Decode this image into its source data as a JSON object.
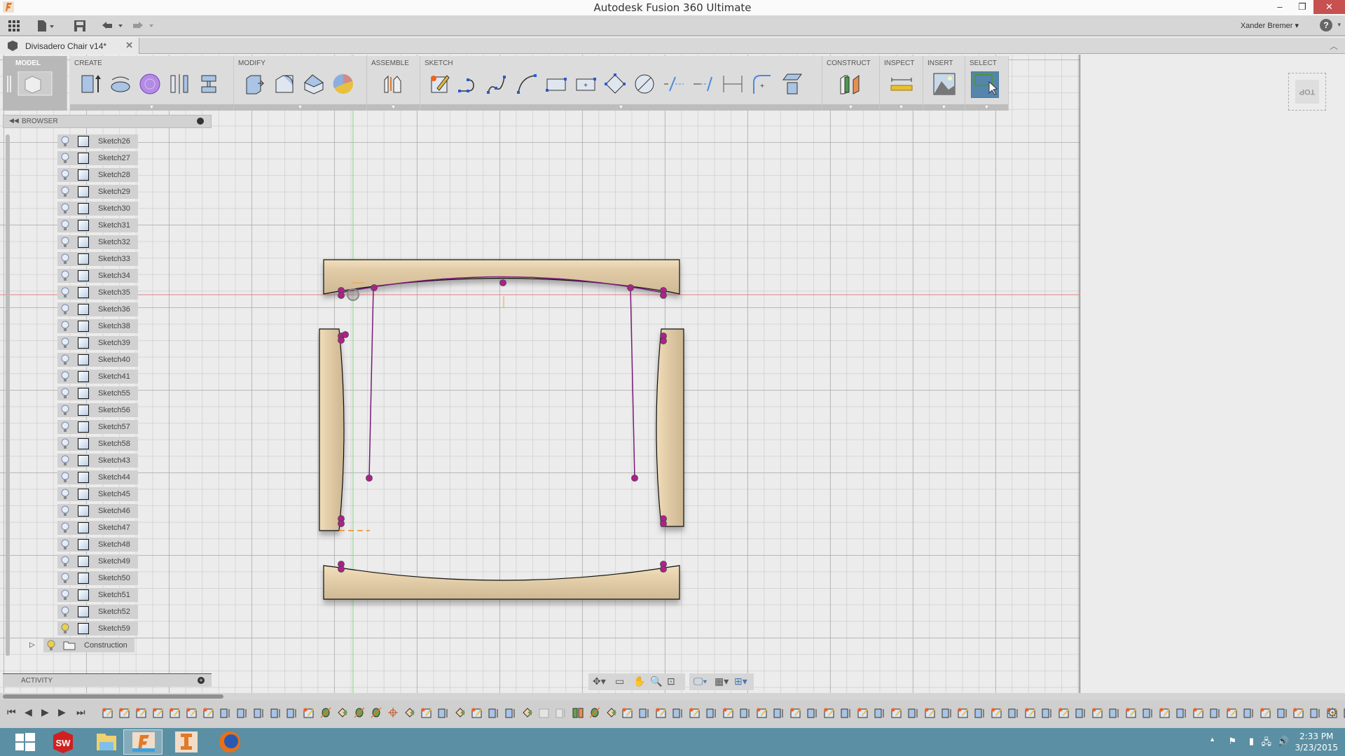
{
  "window": {
    "title": "Autodesk Fusion 360 Ultimate",
    "minimize_icon": "minimize-icon",
    "restore_icon": "restore-icon",
    "close_icon": "close-icon"
  },
  "quick_access": {
    "user_name": "Xander Bremer ▾",
    "help_label": "?",
    "help_caret": "▾"
  },
  "document_tab": {
    "label": "Divisadero Chair v14*",
    "close": "✕"
  },
  "ribbon": {
    "workspace": "MODEL",
    "groups": {
      "create": "CREATE",
      "modify": "MODIFY",
      "assemble": "ASSEMBLE",
      "sketch": "SKETCH",
      "construct": "CONSTRUCT",
      "inspect": "INSPECT",
      "insert": "INSERT",
      "select": "SELECT"
    },
    "dropdown_caret": "▼"
  },
  "browser": {
    "title": "BROWSER",
    "items": [
      {
        "label": "Sketch26"
      },
      {
        "label": "Sketch27"
      },
      {
        "label": "Sketch28"
      },
      {
        "label": "Sketch29"
      },
      {
        "label": "Sketch30"
      },
      {
        "label": "Sketch31"
      },
      {
        "label": "Sketch32"
      },
      {
        "label": "Sketch33"
      },
      {
        "label": "Sketch34"
      },
      {
        "label": "Sketch35"
      },
      {
        "label": "Sketch36"
      },
      {
        "label": "Sketch38"
      },
      {
        "label": "Sketch39"
      },
      {
        "label": "Sketch40"
      },
      {
        "label": "Sketch41"
      },
      {
        "label": "Sketch55"
      },
      {
        "label": "Sketch56"
      },
      {
        "label": "Sketch57"
      },
      {
        "label": "Sketch58"
      },
      {
        "label": "Sketch43"
      },
      {
        "label": "Sketch44"
      },
      {
        "label": "Sketch45"
      },
      {
        "label": "Sketch46"
      },
      {
        "label": "Sketch47"
      },
      {
        "label": "Sketch48"
      },
      {
        "label": "Sketch49"
      },
      {
        "label": "Sketch50"
      },
      {
        "label": "Sketch51"
      },
      {
        "label": "Sketch52"
      },
      {
        "label": "Sketch59",
        "visible": true
      }
    ],
    "folder": {
      "label": "Construction",
      "expand_icon": "▷"
    }
  },
  "activity": {
    "title": "ACTIVITY"
  },
  "viewcube": {
    "face": "TOP"
  },
  "timeline": {
    "controls": [
      "⏮",
      "◀",
      "▶",
      "▶",
      "⏭"
    ],
    "items": [
      "sketch",
      "sketch",
      "sketch",
      "sketch",
      "sketch",
      "sketch",
      "sketch",
      "extrude",
      "extrude",
      "extrude",
      "extrude",
      "extrude",
      "sketch",
      "axis",
      "plane-at-angle",
      "axis",
      "axis",
      "point",
      "plane-at-angle",
      "sketch",
      "extrude",
      "plane-at-angle",
      "sketch",
      "extrude",
      "extrude",
      "plane-at-angle",
      "sketch-suppressed",
      "extrude-suppressed",
      "split",
      "axis",
      "plane-at-angle",
      "sketch",
      "extrude",
      "sketch",
      "extrude",
      "sketch",
      "extrude",
      "sketch",
      "extrude",
      "sketch",
      "extrude",
      "sketch",
      "extrude",
      "sketch",
      "extrude",
      "sketch",
      "extrude",
      "sketch",
      "extrude",
      "sketch",
      "extrude",
      "sketch",
      "extrude",
      "sketch",
      "extrude",
      "sketch",
      "extrude",
      "sketch",
      "extrude",
      "sketch",
      "extrude",
      "sketch",
      "extrude",
      "sketch",
      "extrude",
      "sketch",
      "extrude",
      "sketch",
      "extrude",
      "sketch",
      "extrude",
      "sketch",
      "extrude",
      "sketch",
      "extrude",
      "sketch",
      "extrude",
      "sketch",
      "extrude",
      "sketch",
      "extrude",
      "sketch",
      "extrude",
      "split",
      "sketch",
      "extrude"
    ],
    "settings_icon": "⚙"
  },
  "taskbar": {
    "apps": [
      "windows-start",
      "solidworks",
      "file-explorer",
      "fusion-360",
      "inventor-pro",
      "firefox"
    ],
    "time": "2:33 PM",
    "date": "3/23/2015",
    "tray_caret": "▲"
  },
  "colors": {
    "wood": "#e8d4b0",
    "sketch_curve": "#7a1a7a",
    "sketch_point": "#b0208a",
    "x_axis": "#e07070",
    "y_axis": "#70d070",
    "select_active": "#5585ad",
    "taskbar": "#5b8fa3",
    "close_button": "#c75050"
  }
}
